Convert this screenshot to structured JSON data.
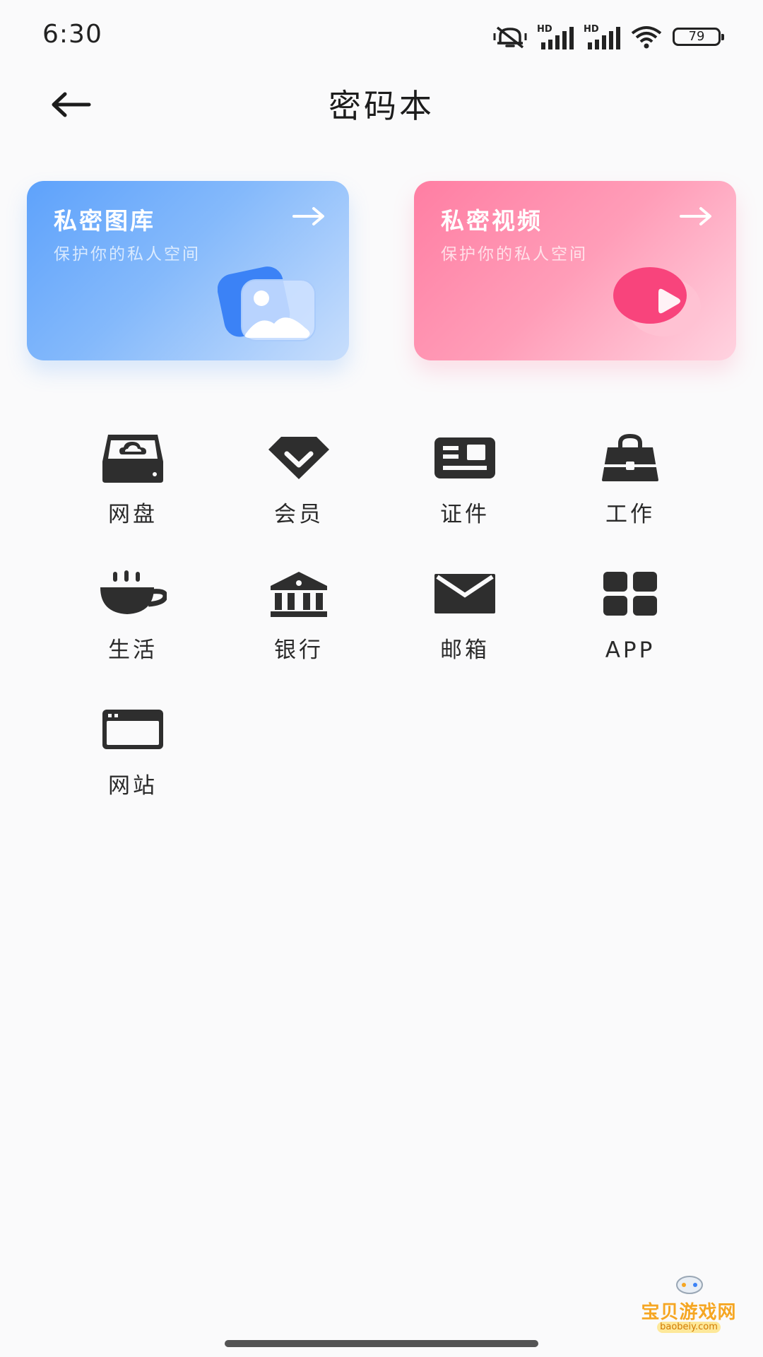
{
  "status_bar": {
    "time": "6:30",
    "battery": "79",
    "signal_1_label": "HD",
    "signal_2_label": "HD"
  },
  "header": {
    "title": "密码本"
  },
  "cards": [
    {
      "title": "私密图库",
      "subtitle": "保护你的私人空间",
      "color": "#5ea2fb",
      "icon": "image-icon"
    },
    {
      "title": "私密视频",
      "subtitle": "保护你的私人空间",
      "color": "#ff7ea3",
      "icon": "video-play-icon"
    }
  ],
  "categories": [
    {
      "label": "网盘",
      "icon": "cloud-drive-icon"
    },
    {
      "label": "会员",
      "icon": "vip-diamond-icon"
    },
    {
      "label": "证件",
      "icon": "id-card-icon"
    },
    {
      "label": "工作",
      "icon": "briefcase-icon"
    },
    {
      "label": "生活",
      "icon": "coffee-cup-icon"
    },
    {
      "label": "银行",
      "icon": "bank-icon"
    },
    {
      "label": "邮箱",
      "icon": "mail-icon"
    },
    {
      "label": "APP",
      "icon": "app-grid-icon"
    },
    {
      "label": "网站",
      "icon": "browser-window-icon"
    }
  ],
  "watermark": {
    "text": "宝贝游戏网",
    "sub": "baobeiy.com"
  }
}
